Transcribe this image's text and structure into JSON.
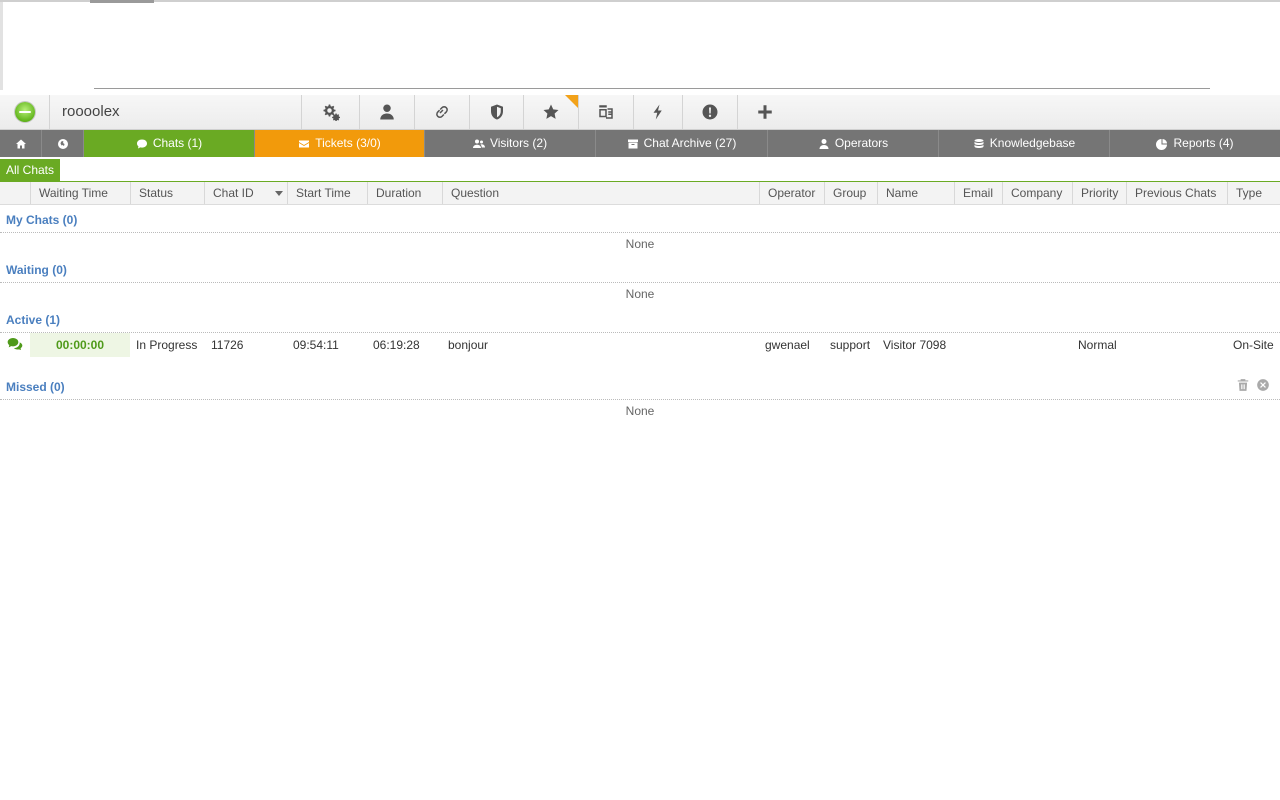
{
  "operator": {
    "name": "roooolex",
    "status_color": "#62b51c"
  },
  "toolbar": {
    "tools": [
      "settings-icon",
      "user-icon",
      "link-icon",
      "shield-icon",
      "star-icon",
      "translate-icon",
      "flash-icon",
      "alert-icon",
      "add-icon"
    ],
    "accent_corner_color": "#f2a21a"
  },
  "nav": {
    "home_icon": "home-icon",
    "globe_icon": "globe-icon",
    "tabs": [
      {
        "label": "Chats (1)",
        "icon": "chat-icon",
        "color": "#6aaa23"
      },
      {
        "label": "Tickets (3/0)",
        "icon": "envelope-icon",
        "color": "#f29a0b"
      },
      {
        "label": "Visitors (2)",
        "icon": "users-icon"
      },
      {
        "label": "Chat Archive (27)",
        "icon": "archive-icon"
      },
      {
        "label": "Operators",
        "icon": "operator-icon"
      },
      {
        "label": "Knowledgebase",
        "icon": "database-icon"
      },
      {
        "label": "Reports (4)",
        "icon": "pie-icon"
      }
    ]
  },
  "subtabs": {
    "all_chats": "All Chats"
  },
  "table": {
    "columns": [
      "Waiting Time",
      "Status",
      "Chat ID",
      "Start Time",
      "Duration",
      "Question",
      "Operator",
      "Group",
      "Name",
      "Email",
      "Company",
      "Priority",
      "Previous Chats",
      "Type"
    ]
  },
  "sections": {
    "my_chats": {
      "title": "My Chats (0)",
      "empty": "None"
    },
    "waiting": {
      "title": "Waiting (0)",
      "empty": "None"
    },
    "active": {
      "title": "Active (1)",
      "rows": [
        {
          "waiting_time": "00:00:00",
          "status": "In Progress",
          "chat_id": "11726",
          "start_time": "09:54:11",
          "duration": "06:19:28",
          "question": "bonjour",
          "operator": "gwenael",
          "group": "support",
          "name": "Visitor 7098",
          "email": "",
          "company": "",
          "priority": "Normal",
          "previous_chats": "",
          "type": "On-Site"
        }
      ]
    },
    "missed": {
      "title": "Missed (0)",
      "empty": "None"
    }
  }
}
